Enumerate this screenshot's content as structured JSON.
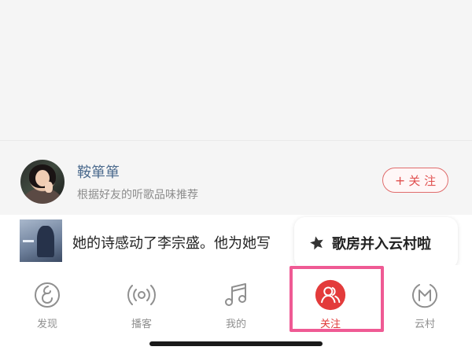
{
  "recommendation": {
    "name": "鞍箪箪",
    "subtitle": "根据好友的听歌品味推荐",
    "follow_plus": "+",
    "follow_label": "关 注"
  },
  "feed": {
    "text": "她的诗感动了李宗盛。他为她写"
  },
  "tooltip": {
    "icon": "star-icon",
    "text": "歌房并入云村啦"
  },
  "tabs": [
    {
      "label": "发现",
      "icon": "discover-icon",
      "active": false
    },
    {
      "label": "播客",
      "icon": "podcast-icon",
      "active": false
    },
    {
      "label": "我的",
      "icon": "music-note-icon",
      "active": false
    },
    {
      "label": "关注",
      "icon": "follow-users-icon",
      "active": true
    },
    {
      "label": "云村",
      "icon": "village-icon",
      "active": false
    }
  ],
  "colors": {
    "accent": "#e03a3a",
    "highlight": "#ef5a94",
    "name_link": "#4b6a8d"
  }
}
